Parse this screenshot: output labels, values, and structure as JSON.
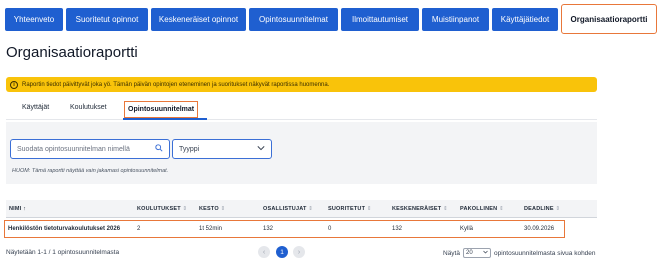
{
  "nav": {
    "tabs": [
      {
        "label": "Yhteenveto"
      },
      {
        "label": "Suoritetut opinnot"
      },
      {
        "label": "Keskeneräiset opinnot"
      },
      {
        "label": "Opintosuunnitelmat"
      },
      {
        "label": "Ilmoittautumiset"
      },
      {
        "label": "Muistiinpanot"
      },
      {
        "label": "Käyttäjätiedot"
      },
      {
        "label": "Organisaatioraportti",
        "active": true
      }
    ]
  },
  "page": {
    "title": "Organisaatioraportti",
    "notice": "Raportin tiedot päivittyvät joka yö. Tämän päivän opintojen eteneminen ja suoritukset näkyvät raportissa huomenna."
  },
  "sub_tabs": [
    {
      "label": "Käyttäjät"
    },
    {
      "label": "Koulutukset"
    },
    {
      "label": "Opintosuunnitelmat",
      "active": true
    }
  ],
  "filters": {
    "search_placeholder": "Suodata opintosuunnitelman nimellä",
    "type_select": "Tyyppi",
    "note": "HUOM: Tämä raportti näyttää vain jakamasi opintosuunnitelmat."
  },
  "table": {
    "headers": [
      "NIMI",
      "KOULUTUKSET",
      "KESTO",
      "OSALLISTUJAT",
      "SUORITETUT",
      "KESKENERÄISET",
      "PAKOLLINEN",
      "DEADLINE"
    ],
    "rows": [
      [
        "Henkilöstön tietoturvakoulutukset 2026",
        "2",
        "1t 52min",
        "132",
        "0",
        "132",
        "Kyllä",
        "30.09.2026"
      ]
    ]
  },
  "footer": {
    "summary": "Näytetään 1-1 / 1 opintosuunnitelmasta",
    "current_page": "1",
    "show_label": "Näytä",
    "page_size": "20",
    "per_page_label": "opintosuunnitelmasta sivua kohden"
  },
  "colors": {
    "primary": "#1f5fd0",
    "highlight": "#e8773a",
    "notice": "#f9c30a"
  }
}
